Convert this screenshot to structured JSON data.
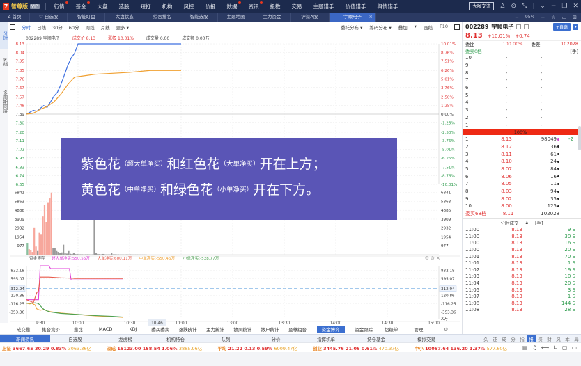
{
  "topbar": {
    "logo": {
      "mark": "7",
      "brand": "智尊版",
      "version": "VIP"
    },
    "nav": [
      {
        "label": "行情",
        "dot": true
      },
      {
        "label": "基金",
        "dot": true
      },
      {
        "label": "大盘",
        "dot": false
      },
      {
        "label": "选股",
        "dot": false
      },
      {
        "label": "短打",
        "dot": false
      },
      {
        "label": "机构",
        "dot": false
      },
      {
        "label": "风控",
        "dot": false
      },
      {
        "label": "价投",
        "dot": false
      },
      {
        "label": "数据",
        "dot": true
      },
      {
        "label": "资讯",
        "dot": true
      },
      {
        "label": "投教",
        "dot": false
      },
      {
        "label": "交易",
        "dot": false
      },
      {
        "label": "主题猎手",
        "dot": false
      },
      {
        "label": "价值猎手",
        "dot": false
      },
      {
        "label": "舆情猎手",
        "dot": false
      }
    ],
    "exchange_button": "大咖交流",
    "window_controls": [
      "user-icon",
      "settings-icon",
      "shrink-icon",
      "chevron-down-icon",
      "minimize-icon",
      "restore-icon",
      "close-icon"
    ]
  },
  "tabbar": {
    "tabs": [
      {
        "label": "⌂ 首页",
        "active": false
      },
      {
        "label": "♡ 自选股",
        "active": false
      },
      {
        "label": "智能盯盘",
        "active": false
      },
      {
        "label": "大盘状态",
        "active": false
      },
      {
        "label": "综合排名",
        "active": false
      },
      {
        "label": "智能选股",
        "active": false
      },
      {
        "label": "主题地图",
        "active": false
      },
      {
        "label": "主力资金",
        "active": false
      },
      {
        "label": "沪深A股",
        "active": false
      },
      {
        "label": "宇顺电子",
        "active": true
      }
    ],
    "zoom": "95%",
    "right_icons": [
      "minus-icon",
      "plus-icon",
      "star-icon",
      "monitor-icon",
      "layout-icon"
    ]
  },
  "leftrail": [
    {
      "label": "分时",
      "active": true
    },
    {
      "label": "K线",
      "active": false
    },
    {
      "label": "多周期同屏",
      "active": false
    }
  ],
  "charttool": {
    "periods": [
      "分时",
      "日线",
      "30分",
      "60分",
      "周线",
      "月线",
      "更多 ▾"
    ],
    "active": "分时",
    "right": [
      "委托分布 ▾",
      "筹码分布 ▾",
      "叠加",
      "▾",
      "画线",
      "F10"
    ]
  },
  "quote_line": {
    "code": "002289",
    "name": "宇顺电子",
    "price_label": "成交价 8.13",
    "change_label": "涨幅 10.01%",
    "volume_label": "成交量 0.00",
    "amount_label": "成交额 0.00万"
  },
  "overlay": {
    "line1": [
      {
        "t": "紫色花",
        "s": false
      },
      {
        "t": "（超大单净买）",
        "s": true
      },
      {
        "t": "和红色花",
        "s": false
      },
      {
        "t": "（大单净买）",
        "s": true
      },
      {
        "t": "开在上方；",
        "s": false
      }
    ],
    "line2": [
      {
        "t": "黄色花",
        "s": false
      },
      {
        "t": "（中单净买）",
        "s": true
      },
      {
        "t": "和绿色花",
        "s": false
      },
      {
        "t": "（小单净买）",
        "s": true
      },
      {
        "t": "开在下方。",
        "s": false
      }
    ]
  },
  "chart_data": [
    {
      "type": "line",
      "title": "002289 宇顺电子 分时",
      "y_left_ticks": [
        "8.13",
        "8.04",
        "7.95",
        "7.85",
        "7.76",
        "7.67",
        "7.57",
        "7.48",
        "7.39",
        "7.30",
        "7.20",
        "7.11",
        "7.02",
        "6.93",
        "6.83",
        "6.74",
        "6.65"
      ],
      "y_right_ticks": [
        "10.01%",
        "8.76%",
        "7.51%",
        "6.26%",
        "5.01%",
        "3.76%",
        "2.50%",
        "1.25%",
        "0.00%",
        "-1.25%",
        "-2.50%",
        "-3.76%",
        "-5.01%",
        "-6.26%",
        "-7.51%",
        "-8.76%",
        "-10.01%"
      ],
      "ylim": [
        6.65,
        8.13
      ],
      "prev_close": 7.39,
      "x_ticks": [
        "9:30",
        "10:00",
        "10:30",
        "10:46",
        "11:00",
        "13:00",
        "13:30",
        "14:00",
        "14:30",
        "15:00"
      ],
      "cursor_time": "10:46",
      "series": [
        {
          "name": "价格",
          "color": "#3d6fe0",
          "x": [
            0,
            2,
            4,
            6,
            8,
            10,
            12,
            14,
            16,
            18,
            20,
            22,
            24,
            26,
            28,
            30,
            32,
            90
          ],
          "y": [
            7.39,
            7.41,
            7.43,
            7.42,
            7.45,
            7.48,
            7.46,
            7.52,
            7.58,
            7.62,
            7.7,
            7.8,
            7.9,
            7.98,
            8.03,
            8.13,
            8.13,
            8.13
          ]
        },
        {
          "name": "均价",
          "color": "#f0a030",
          "x": [
            0,
            4,
            8,
            12,
            16,
            20,
            24,
            28,
            32,
            40,
            50,
            60,
            72,
            80,
            90
          ],
          "y": [
            7.39,
            7.4,
            7.44,
            7.47,
            7.52,
            7.6,
            7.7,
            7.78,
            7.79,
            7.81,
            7.82,
            7.83,
            7.85,
            7.85,
            7.85
          ]
        }
      ]
    },
    {
      "type": "bar",
      "title": "成交量",
      "y_ticks": [
        "6841",
        "5863",
        "4886",
        "3909",
        "2932",
        "1954",
        "977"
      ],
      "ylim": [
        0,
        7200
      ],
      "values": [
        1300,
        600,
        500,
        300,
        3000,
        900,
        400,
        2400,
        2200,
        4200,
        5500,
        3600,
        5700,
        6200,
        6841,
        700,
        700,
        400,
        300,
        200,
        250,
        1100,
        150,
        120,
        400,
        100,
        80,
        200,
        60,
        60,
        50,
        40,
        40,
        30,
        40,
        40,
        30,
        30,
        30,
        4600,
        150,
        80,
        60,
        40,
        80,
        40,
        30,
        30,
        30,
        200,
        40,
        40,
        30,
        30,
        20,
        20,
        20,
        20,
        40,
        20,
        30,
        20,
        20,
        20,
        20,
        20,
        15,
        15,
        15,
        15
      ],
      "red_indices": [
        1,
        2,
        3,
        4,
        5,
        7,
        8,
        9,
        10,
        11,
        12,
        13,
        14
      ]
    },
    {
      "type": "line",
      "title": "资金博弈",
      "legend": [
        {
          "name": "超大单净买",
          "value": "550.55万",
          "color": "#e040d8"
        },
        {
          "name": "大单净买",
          "value": "600.11万",
          "color": "#e85a4a"
        },
        {
          "name": "中单净买",
          "value": "-550.46万",
          "color": "#f0a030"
        },
        {
          "name": "小单净买",
          "value": "-538.77万",
          "color": "#4aa050"
        }
      ],
      "y_ticks": [
        "832.18",
        "595.07",
        "312.94",
        "120.86",
        "-116.25",
        "-353.36"
      ],
      "y_unit": "X万",
      "ylim": [
        -460,
        960
      ],
      "cursor_value": "312.94",
      "series": [
        {
          "name": "超大单净买",
          "color": "#e040d8",
          "x": [
            0,
            7,
            8,
            13,
            14,
            25,
            26,
            33,
            56
          ],
          "y": [
            0,
            0,
            960,
            960,
            880,
            880,
            560,
            560,
            560
          ]
        },
        {
          "name": "大单净买",
          "color": "#e85a4a",
          "x": [
            0,
            4,
            6,
            7,
            8,
            13,
            20,
            26,
            28,
            33,
            56
          ],
          "y": [
            0,
            -80,
            200,
            250,
            640,
            640,
            620,
            610,
            600,
            600,
            600
          ]
        },
        {
          "name": "中单净买",
          "color": "#f0a030",
          "x": [
            0,
            2,
            3,
            5,
            6,
            8,
            10,
            12,
            14,
            20,
            30,
            40,
            50,
            56
          ],
          "y": [
            -100,
            -120,
            -100,
            -150,
            -260,
            -300,
            -280,
            -320,
            -340,
            -380,
            -420,
            -460,
            -480,
            -500
          ]
        },
        {
          "name": "小单净买",
          "color": "#4aa050",
          "x": [
            0,
            3,
            5,
            7,
            8,
            10,
            12,
            14,
            20,
            30,
            40,
            50,
            56
          ],
          "y": [
            -100,
            -100,
            -90,
            -110,
            -170,
            -270,
            -320,
            -350,
            -390,
            -420,
            -450,
            -470,
            -490
          ]
        }
      ]
    }
  ],
  "indicator_tabs": [
    "成交量",
    "集合竞价",
    "量比",
    "MACD",
    "KDJ",
    "委买委卖",
    "涨跌统计",
    "主力统计",
    "散风统计",
    "散户统计",
    "至尊组合",
    "资金博弈",
    "资金跟踪",
    "超级单",
    "管理",
    "⊙"
  ],
  "indicator_active": "资金博弈",
  "right_panel": {
    "code": "002289",
    "name": "宇顺电子",
    "add_button": "+自选",
    "price": "8.13",
    "change_pct": "+10.01%",
    "change": "+0.74",
    "ratio_label": "委比",
    "ratio": "100.00%",
    "diff_label": "委差",
    "diff": "102028",
    "sell_header": "委卖0档",
    "sell_header_unit": "[手]",
    "asks": [
      {
        "lvl": "10",
        "price": "-",
        "vol": "-"
      },
      {
        "lvl": "9",
        "price": "-",
        "vol": "-"
      },
      {
        "lvl": "8",
        "price": "-",
        "vol": "-"
      },
      {
        "lvl": "7",
        "price": "-",
        "vol": "-"
      },
      {
        "lvl": "6",
        "price": "-",
        "vol": "-"
      },
      {
        "lvl": "5",
        "price": "-",
        "vol": "-"
      },
      {
        "lvl": "4",
        "price": "-",
        "vol": "-"
      },
      {
        "lvl": "3",
        "price": "-",
        "vol": "-"
      },
      {
        "lvl": "2",
        "price": "-",
        "vol": "-"
      },
      {
        "lvl": "1",
        "price": "-",
        "vol": "-"
      }
    ],
    "buy_pct": "100%",
    "bids": [
      {
        "lvl": "1",
        "price": "8.13",
        "vol": "98049",
        "chg": "-2",
        "purple": true
      },
      {
        "lvl": "2",
        "price": "8.12",
        "vol": "36",
        "chg": "",
        "purple": false
      },
      {
        "lvl": "3",
        "price": "8.11",
        "vol": "61",
        "chg": "",
        "purple": false
      },
      {
        "lvl": "4",
        "price": "8.10",
        "vol": "24",
        "chg": "",
        "purple": false
      },
      {
        "lvl": "5",
        "price": "8.07",
        "vol": "84",
        "chg": "",
        "purple": false
      },
      {
        "lvl": "6",
        "price": "8.06",
        "vol": "16",
        "chg": "",
        "purple": false
      },
      {
        "lvl": "7",
        "price": "8.05",
        "vol": "11",
        "chg": "",
        "purple": false
      },
      {
        "lvl": "8",
        "price": "8.03",
        "vol": "94",
        "chg": "",
        "purple": false
      },
      {
        "lvl": "9",
        "price": "8.02",
        "vol": "35",
        "chg": "",
        "purple": false
      },
      {
        "lvl": "10",
        "price": "8.00",
        "vol": "125",
        "chg": "",
        "purple": false
      }
    ],
    "buy_total_label": "委买68档",
    "buy_total_price": "8.11",
    "buy_total_vol": "102028",
    "ticks_header": "分时成交",
    "ticks_unit": "[手]",
    "ticks": [
      {
        "t": "11:00",
        "p": "8.13",
        "v": "9 S"
      },
      {
        "t": "11:00",
        "p": "8.13",
        "v": "30 S"
      },
      {
        "t": "11:00",
        "p": "8.13",
        "v": "16 S"
      },
      {
        "t": "11:00",
        "p": "8.13",
        "v": "20 S"
      },
      {
        "t": "11:01",
        "p": "8.13",
        "v": "70 S"
      },
      {
        "t": "11:01",
        "p": "8.13",
        "v": "1 S"
      },
      {
        "t": "11:02",
        "p": "8.13",
        "v": "19 S"
      },
      {
        "t": "11:03",
        "p": "8.13",
        "v": "10 S"
      },
      {
        "t": "11:04",
        "p": "8.13",
        "v": "20 S"
      },
      {
        "t": "11:05",
        "p": "8.13",
        "v": "3 S"
      },
      {
        "t": "11:07",
        "p": "8.13",
        "v": "1 S"
      },
      {
        "t": "11:08",
        "p": "8.13",
        "v": "144 S"
      },
      {
        "t": "11:08",
        "p": "8.13",
        "v": "28 S"
      }
    ]
  },
  "newsbar": {
    "tabs": [
      "新闻资讯",
      "自选股",
      "龙虎榜",
      "机构持仓",
      "队列",
      "分价",
      "指挥机单",
      "持仓基金",
      "模拟交易"
    ],
    "active": "新闻资讯",
    "side_icons": [
      "久",
      "还",
      "成",
      "分",
      "指",
      "报",
      "资",
      "财",
      "风",
      "本",
      "异"
    ],
    "side_active": "报"
  },
  "status": [
    {
      "label": "上证",
      "val": "3667.65",
      "chg": "30.29",
      "pct": "0.83%",
      "amt": "3063.36亿"
    },
    {
      "label": "深成",
      "val": "15123.00",
      "chg": "158.54",
      "pct": "1.06%",
      "amt": "3885.96亿"
    },
    {
      "label": "平均",
      "val": "21.22",
      "chg": "0.13",
      "pct": "0.59%",
      "amt": "6909.47亿"
    },
    {
      "label": "创业",
      "val": "3445.76",
      "chg": "21.06",
      "pct": "0.61%",
      "amt": "470.37亿"
    },
    {
      "label": "中小",
      "val": "10067.64",
      "chg": "136.20",
      "pct": "1.37%",
      "amt": "577.60亿"
    }
  ]
}
